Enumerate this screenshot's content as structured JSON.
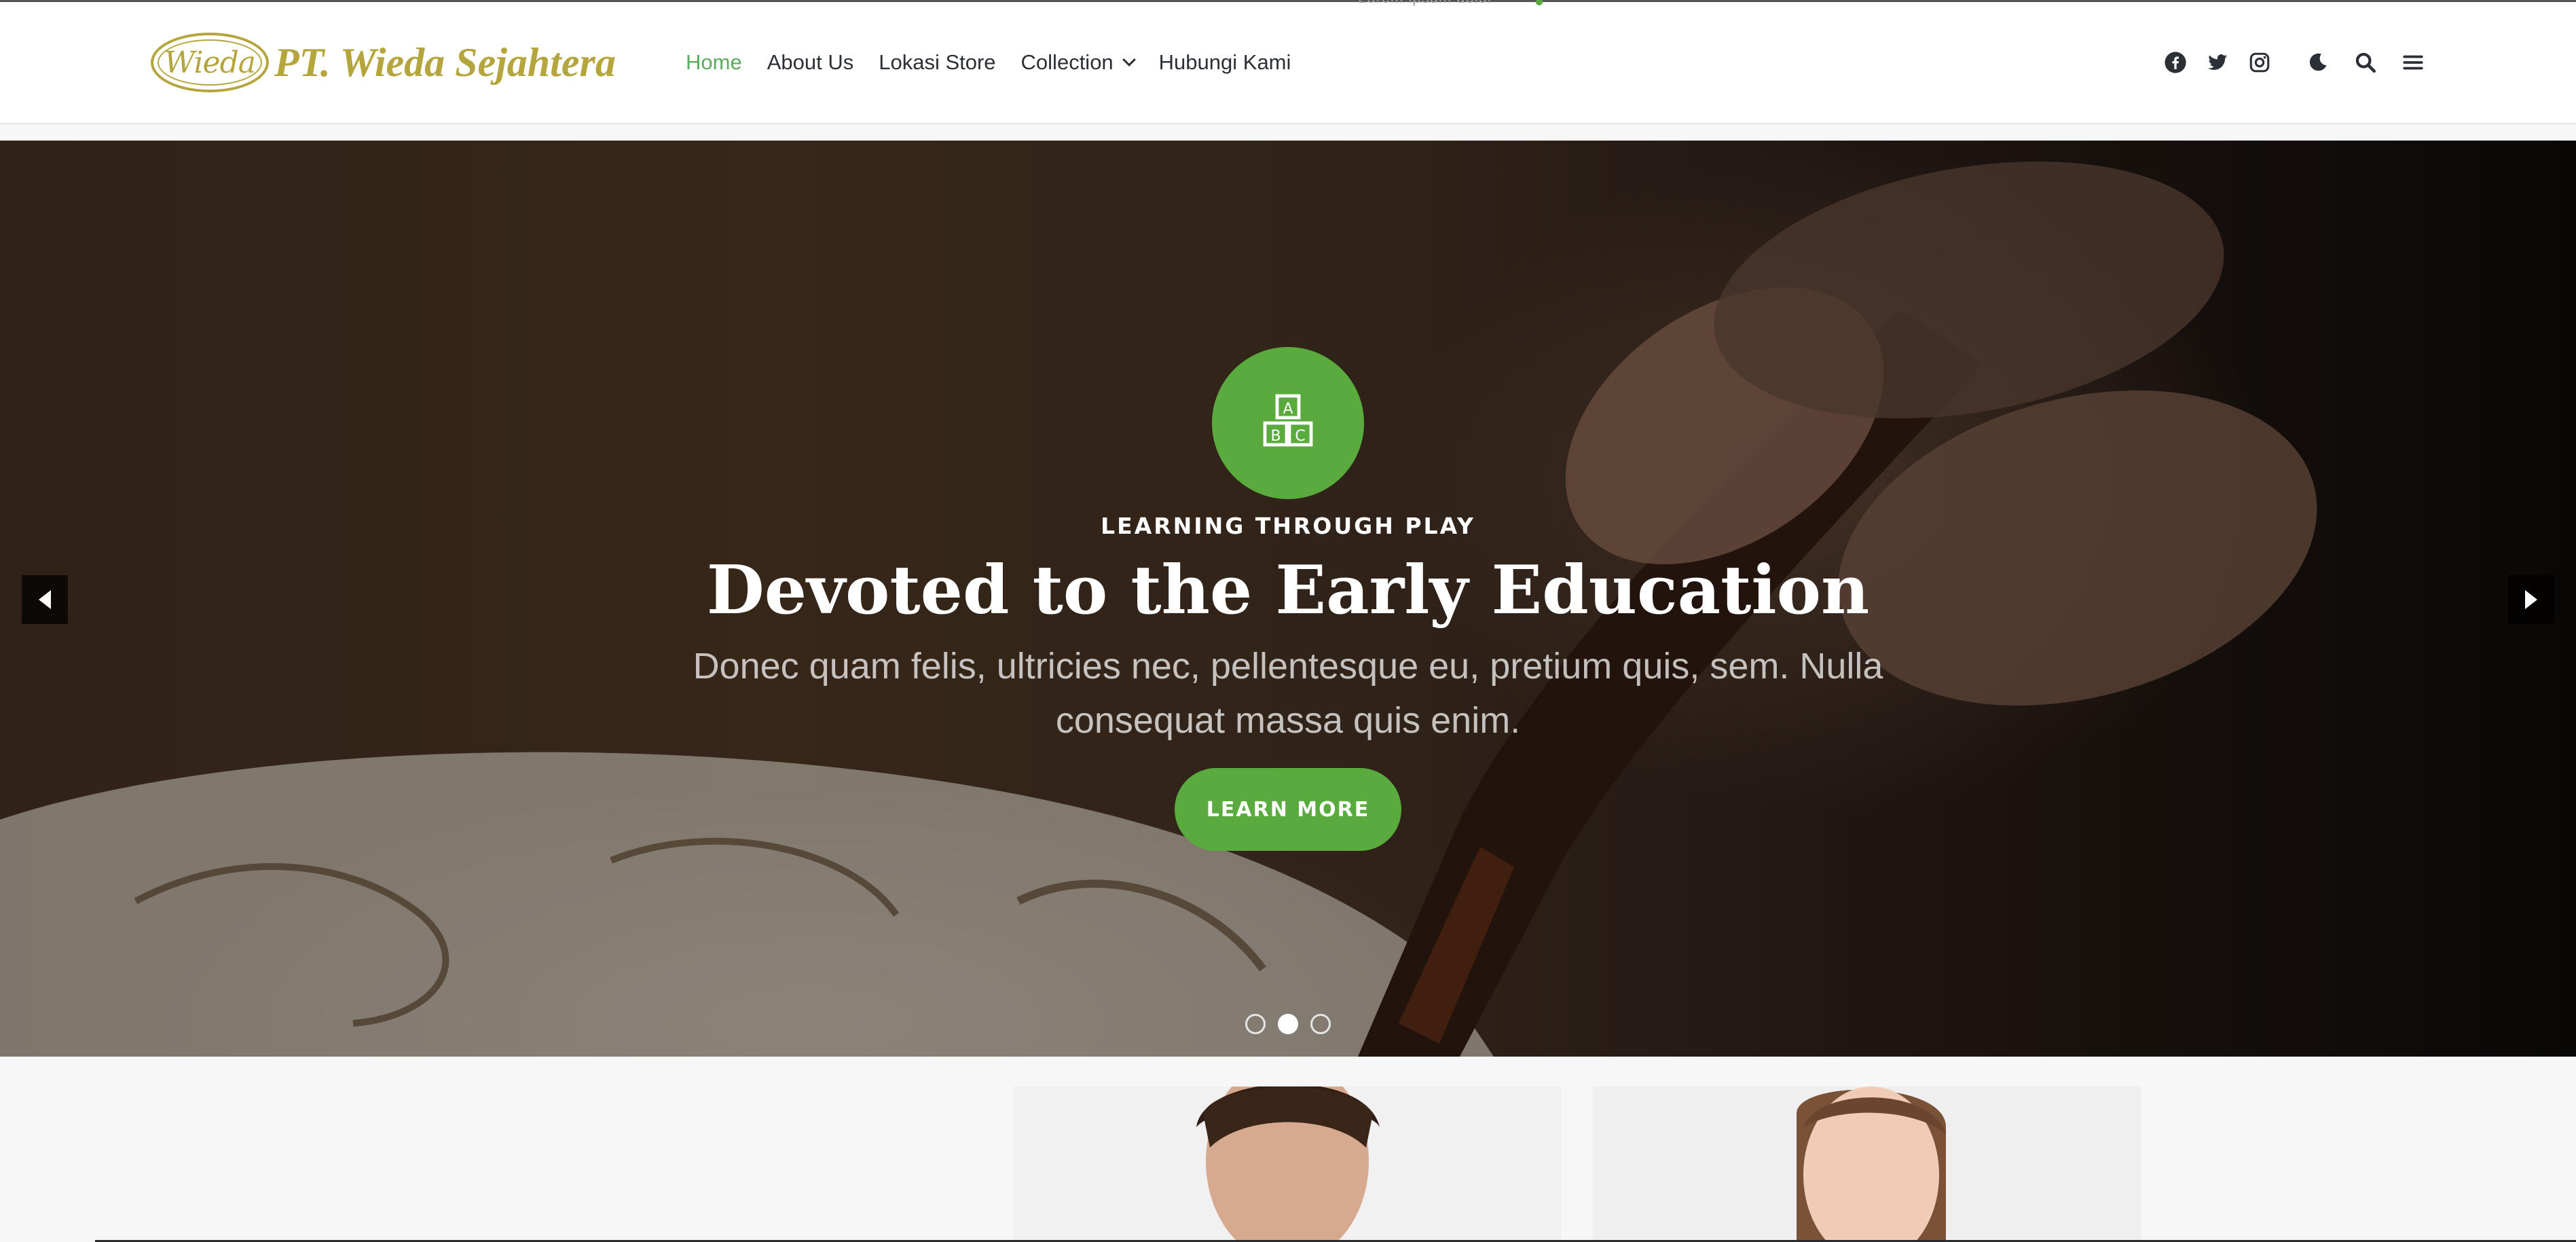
{
  "header": {
    "overflow_text": "Lorem ipsum dolor",
    "logo": {
      "mark": "Wieda",
      "text": "PT. Wieda Sejahtera",
      "color": "#b5a53d"
    },
    "nav": [
      {
        "label": "Home",
        "active": true
      },
      {
        "label": "About Us"
      },
      {
        "label": "Lokasi Store"
      },
      {
        "label": "Collection",
        "has_dropdown": true
      },
      {
        "label": "Hubungi Kami"
      }
    ],
    "icons": [
      "facebook-icon",
      "twitter-icon",
      "instagram-icon",
      "moon-icon",
      "search-icon",
      "menu-icon"
    ]
  },
  "hero": {
    "badge_icon": "abc-blocks-icon",
    "badge_letters": [
      "A",
      "B",
      "C"
    ],
    "kicker": "LEARNING THROUGH PLAY",
    "title": "Devoted to the Early Education",
    "description": "Donec quam felis, ultricies nec, pellentesque eu, pretium quis, sem. Nulla consequat massa quis enim.",
    "button_label": "LEARN MORE",
    "slides_total": 3,
    "active_slide": 2
  },
  "colors": {
    "accent": "#5aab3e",
    "nav_active": "#5aab5e",
    "text_dark": "#2b2f36"
  }
}
